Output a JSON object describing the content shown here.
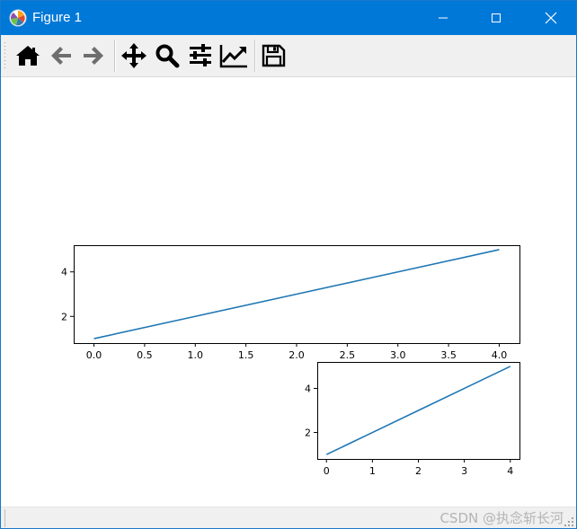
{
  "window": {
    "title": "Figure 1"
  },
  "colors": {
    "titlebar": "#0078d7",
    "line": "#1f77b4",
    "toolbar_bg": "#f0f0f0"
  },
  "toolbar": {
    "buttons": [
      {
        "name": "home",
        "icon": "home-icon"
      },
      {
        "name": "back",
        "icon": "arrow-left-icon"
      },
      {
        "name": "forward",
        "icon": "arrow-right-icon"
      },
      {
        "name": "pan",
        "icon": "move-icon"
      },
      {
        "name": "zoom",
        "icon": "magnifier-icon"
      },
      {
        "name": "subplots",
        "icon": "sliders-icon"
      },
      {
        "name": "customize",
        "icon": "line-chart-icon"
      },
      {
        "name": "save",
        "icon": "floppy-disk-icon"
      }
    ]
  },
  "status": {
    "watermark": "CSDN @执念斩长河"
  },
  "chart_data": [
    {
      "type": "line",
      "x": [
        0,
        1,
        2,
        3,
        4
      ],
      "series": [
        {
          "values": [
            1,
            2,
            3,
            4,
            5
          ]
        }
      ],
      "xlim": [
        -0.2,
        4.2
      ],
      "ylim": [
        0.8,
        5.2
      ],
      "xticks": [
        "0.0",
        "0.5",
        "1.0",
        "1.5",
        "2.0",
        "2.5",
        "3.0",
        "3.5",
        "4.0"
      ],
      "xtick_values": [
        0,
        0.5,
        1,
        1.5,
        2,
        2.5,
        3,
        3.5,
        4
      ],
      "yticks": [
        "2",
        "4"
      ],
      "ytick_values": [
        2,
        4
      ],
      "title": "",
      "xlabel": "",
      "ylabel": "",
      "grid": false
    },
    {
      "type": "line",
      "x": [
        0,
        1,
        2,
        3,
        4
      ],
      "series": [
        {
          "values": [
            1,
            2,
            3,
            4,
            5
          ]
        }
      ],
      "xlim": [
        -0.2,
        4.2
      ],
      "ylim": [
        0.8,
        5.2
      ],
      "xticks": [
        "0",
        "1",
        "2",
        "3",
        "4"
      ],
      "xtick_values": [
        0,
        1,
        2,
        3,
        4
      ],
      "yticks": [
        "2",
        "4"
      ],
      "ytick_values": [
        2,
        4
      ],
      "title": "",
      "xlabel": "",
      "ylabel": "",
      "grid": false
    }
  ]
}
